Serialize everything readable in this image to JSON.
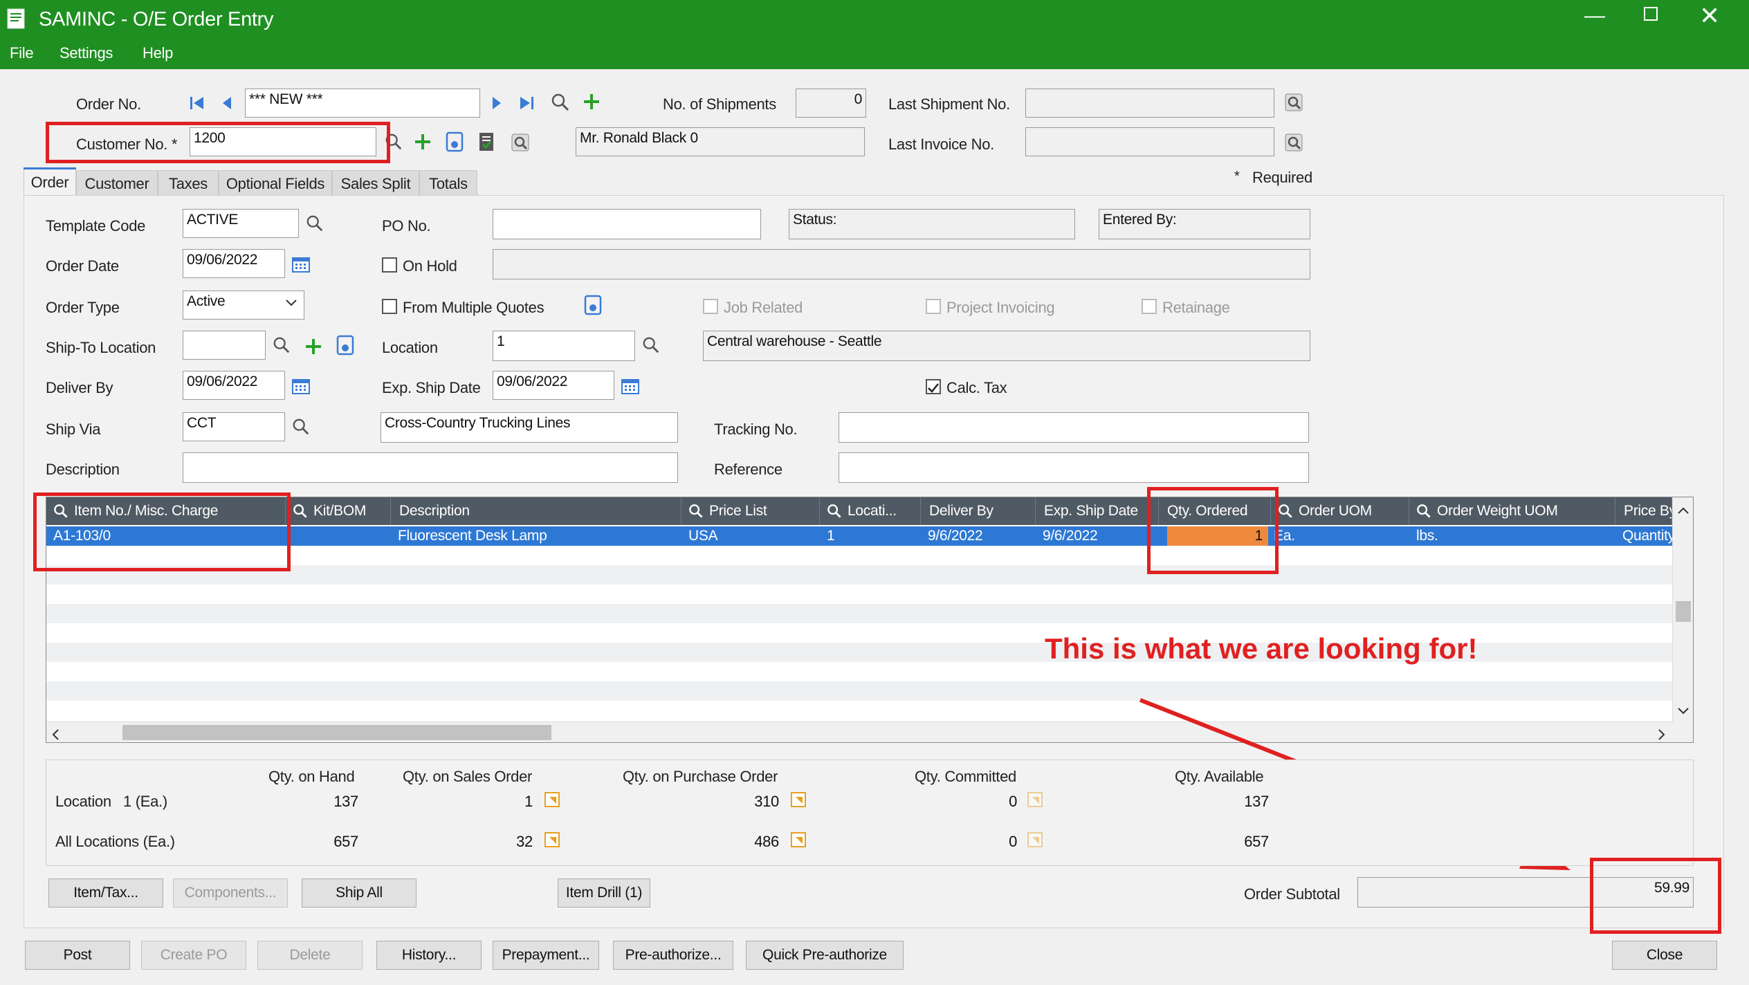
{
  "window": {
    "title": "SAMINC - O/E Order Entry"
  },
  "menu": [
    "File",
    "Settings",
    "Help"
  ],
  "header": {
    "order_no_label": "Order No.",
    "order_no_value": "*** NEW ***",
    "customer_no_label": "Customer No. *",
    "customer_no_value": "1200",
    "customer_name": "Mr. Ronald Black 0",
    "shipments_label": "No. of Shipments",
    "shipments_value": "0",
    "last_shipment_label": "Last Shipment No.",
    "last_invoice_label": "Last Invoice No.",
    "required_star": "*",
    "required_label": "Required"
  },
  "tabs": [
    "Order",
    "Customer",
    "Taxes",
    "Optional Fields",
    "Sales Split",
    "Totals"
  ],
  "order": {
    "template_code_label": "Template Code",
    "template_code": "ACTIVE",
    "po_no_label": "PO No.",
    "status_label": "Status:",
    "entered_by_label": "Entered By:",
    "order_date_label": "Order Date",
    "order_date": "09/06/2022",
    "on_hold_label": "On Hold",
    "order_type_label": "Order Type",
    "order_type": "Active",
    "multiple_quotes_label": "From Multiple Quotes",
    "job_related_label": "Job Related",
    "project_invoicing_label": "Project Invoicing",
    "retainage_label": "Retainage",
    "ship_to_label": "Ship-To Location",
    "location_label": "Location",
    "location_value": "1",
    "location_desc": "Central warehouse - Seattle",
    "deliver_by_label": "Deliver By",
    "deliver_by": "09/06/2022",
    "exp_ship_label": "Exp. Ship Date",
    "exp_ship": "09/06/2022",
    "calc_tax_label": "Calc. Tax",
    "ship_via_label": "Ship Via",
    "ship_via": "CCT",
    "ship_via_desc": "Cross-Country Trucking Lines",
    "tracking_label": "Tracking No.",
    "description_label": "Description",
    "reference_label": "Reference"
  },
  "grid": {
    "headers": [
      "Item No./ Misc. Charge",
      "Kit/BOM",
      "Description",
      "Price List",
      "Locati...",
      "Deliver By",
      "Exp. Ship Date",
      "Qty. Ordered",
      "Order UOM",
      "Order Weight UOM",
      "Price By"
    ],
    "row": {
      "item": "A1-103/0",
      "kit": "",
      "description": "Fluorescent Desk Lamp",
      "price_list": "USA",
      "location": "1",
      "deliver_by": "9/6/2022",
      "exp_ship": "9/6/2022",
      "qty": "1",
      "uom": "Ea.",
      "weight_uom": "lbs.",
      "price_by": "Quantity"
    }
  },
  "annotation": {
    "text": "This is what we are looking for!",
    "color": "#e02020"
  },
  "quantities": {
    "headers": [
      "Qty. on Hand",
      "Qty. on Sales Order",
      "Qty. on Purchase Order",
      "Qty. Committed",
      "Qty. Available"
    ],
    "rows": [
      {
        "label": "Location",
        "loc": "1 (Ea.)",
        "on_hand": "137",
        "on_so": "1",
        "on_po": "310",
        "committed": "0",
        "available": "137"
      },
      {
        "label": "All Locations (Ea.)",
        "loc": "",
        "on_hand": "657",
        "on_so": "32",
        "on_po": "486",
        "committed": "0",
        "available": "657"
      }
    ]
  },
  "buttons": {
    "item_tax": "Item/Tax...",
    "components": "Components...",
    "ship_all": "Ship All",
    "item_drill": "Item Drill (1)",
    "post": "Post",
    "create_po": "Create PO",
    "delete": "Delete",
    "history": "History...",
    "prepayment": "Prepayment...",
    "preauthorize": "Pre-authorize...",
    "quick_preauthorize": "Quick Pre-authorize",
    "close": "Close"
  },
  "subtotal": {
    "label": "Order Subtotal",
    "value": "59.99"
  },
  "colors": {
    "title_bar": "#1f8f22",
    "selected_row": "#2d78d4",
    "grid_header": "#505a64",
    "qty_cell": "#ef8a3c",
    "highlight": "#e02020"
  }
}
